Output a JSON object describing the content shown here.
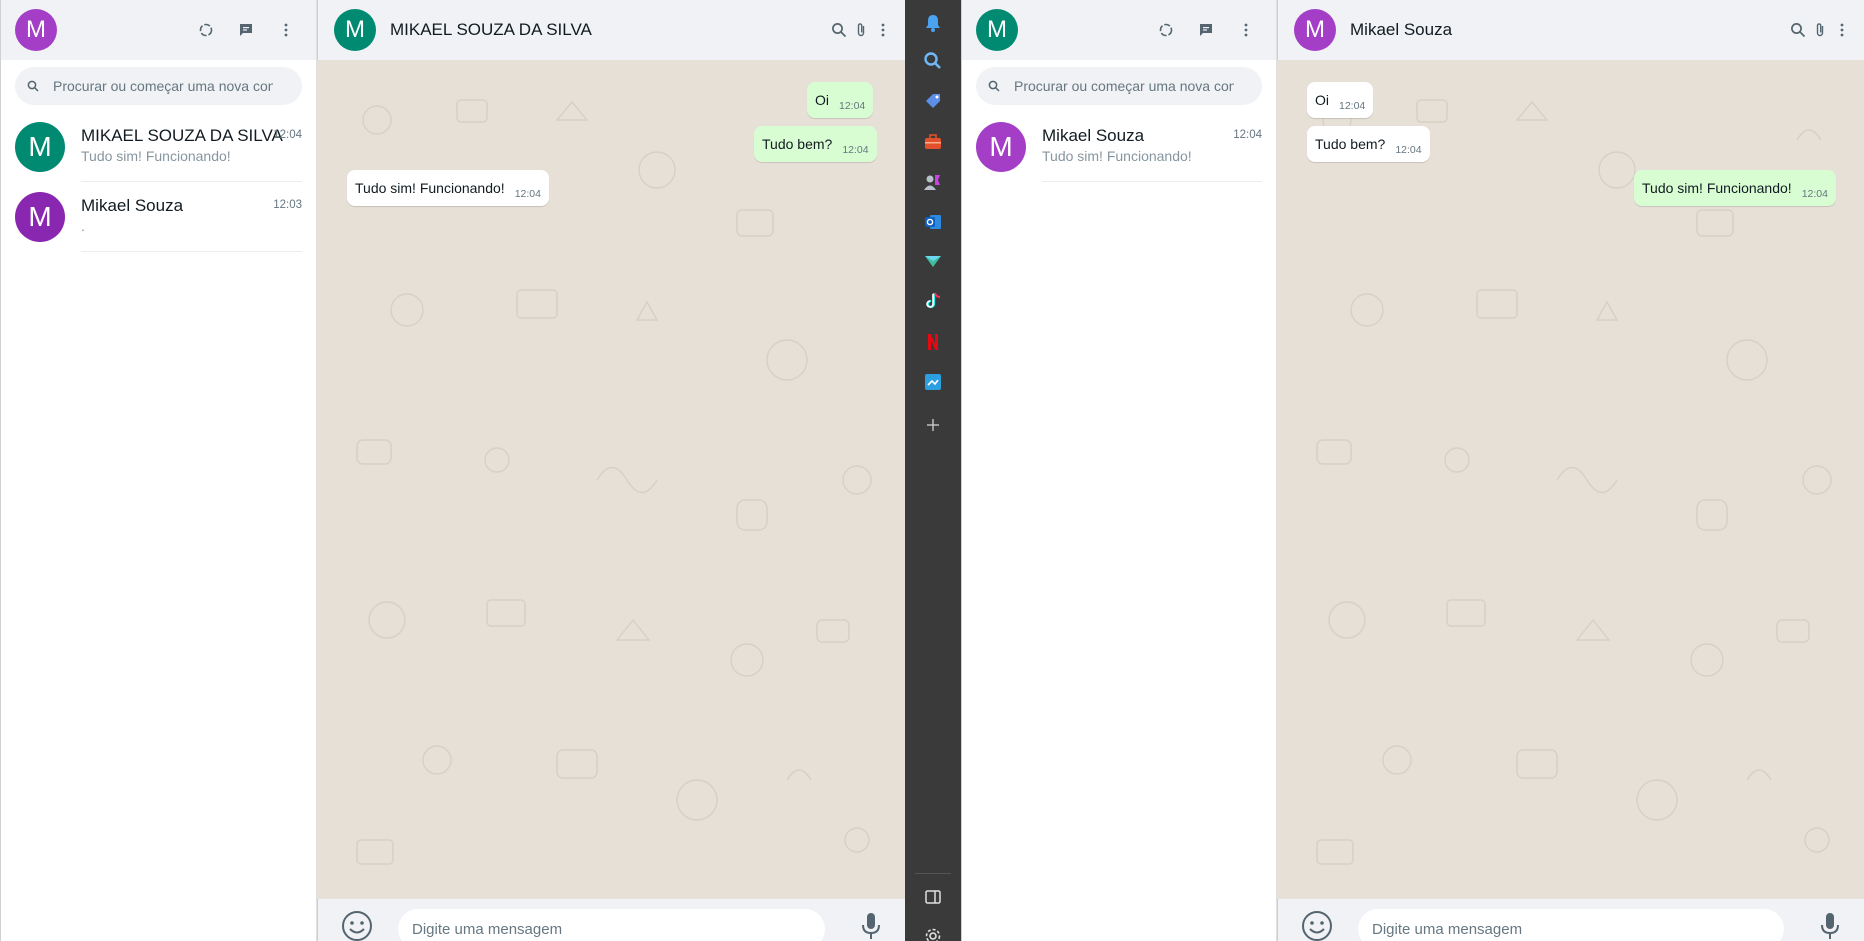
{
  "colors": {
    "teal_avatar": "#008a72",
    "purple_avatar": "#a43ec7",
    "outgoing_bubble": "#d9fdd3",
    "chat_background": "#e7e0d7",
    "dock_background": "#3a3a3a"
  },
  "session_a": {
    "profile_initial": "M",
    "search_placeholder": "Procurar ou começar uma nova conversa",
    "chats": [
      {
        "initial": "M",
        "name": "MIKAEL SOUZA DA SILVA",
        "time": "12:04",
        "last_message": "Tudo sim! Funcionando!"
      },
      {
        "initial": "M",
        "name": "Mikael Souza",
        "time": "12:03",
        "last_message": "."
      }
    ],
    "open_chat": {
      "initial": "M",
      "name": "MIKAEL SOUZA DA SILVA",
      "messages": [
        {
          "text": "Oi",
          "time": "12:04",
          "direction": "out"
        },
        {
          "text": "Tudo bem?",
          "time": "12:04",
          "direction": "out"
        },
        {
          "text": "Tudo sim! Funcionando!",
          "time": "12:04",
          "direction": "in"
        }
      ],
      "composer_placeholder": "Digite uma mensagem"
    }
  },
  "session_b": {
    "profile_initial": "M",
    "search_placeholder": "Procurar ou começar uma nova conversa",
    "chats": [
      {
        "initial": "M",
        "name": "Mikael Souza",
        "time": "12:04",
        "last_message": "Tudo sim! Funcionando!"
      }
    ],
    "open_chat": {
      "initial": "M",
      "name": "Mikael Souza",
      "messages": [
        {
          "text": "Oi",
          "time": "12:04",
          "direction": "in"
        },
        {
          "text": "Tudo bem?",
          "time": "12:04",
          "direction": "in"
        },
        {
          "text": "Tudo sim! Funcionando!",
          "time": "12:04",
          "direction": "out"
        }
      ],
      "composer_placeholder": "Digite uma mensagem"
    }
  },
  "dock": {
    "items": [
      "bell-icon",
      "search-icon",
      "tag-icon",
      "toolbox-icon",
      "users-icon",
      "outlook-icon",
      "send-icon",
      "tiktok-icon",
      "netflix-icon",
      "screenshot-icon",
      "add-icon",
      "panel-icon",
      "settings-icon"
    ]
  }
}
